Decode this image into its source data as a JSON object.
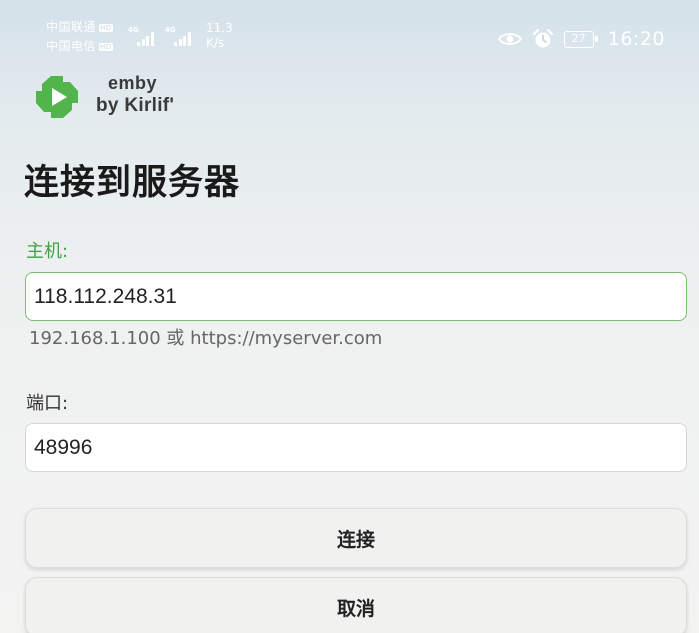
{
  "status_bar": {
    "carrier_1": "中国联通",
    "carrier_2": "中国电信",
    "sim_badge": "HD",
    "network_type": "4G",
    "speed_value": "11.3",
    "speed_unit": "K/s",
    "battery_level": "27",
    "time": "16:20",
    "icons": [
      "eye-icon",
      "alarm-icon",
      "battery-icon",
      "signal-icon"
    ]
  },
  "app": {
    "logo_name": "emby",
    "logo_sub": "by Kirlif'",
    "brand_color": "#52b54b"
  },
  "form": {
    "title": "连接到服务器",
    "host_label": "主机:",
    "host_value": "118.112.248.31",
    "host_hint": "192.168.1.100 或 https://myserver.com",
    "port_label": "端口:",
    "port_value": "48996",
    "accent_color": "#43a047"
  },
  "buttons": {
    "connect_label": "连接",
    "cancel_label": "取消"
  }
}
